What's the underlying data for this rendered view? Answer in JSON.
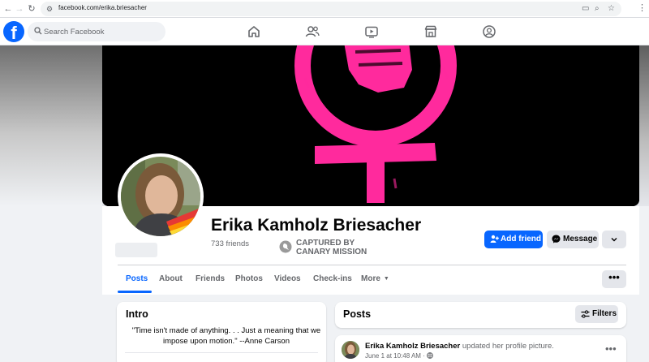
{
  "browser": {
    "url": "facebook.com/erika.briesacher"
  },
  "fb_header": {
    "search_placeholder": "Search Facebook",
    "nav_icons": [
      "home-icon",
      "friends-icon",
      "watch-icon",
      "marketplace-icon",
      "groups-icon"
    ]
  },
  "profile": {
    "name": "Erika Kamholz Briesacher",
    "friends": "733 friends",
    "badge_line1": "CAPTURED BY",
    "badge_line2": "CANARY MISSION"
  },
  "actions": {
    "add_friend": "Add friend",
    "message": "Message"
  },
  "tabs": [
    {
      "label": "Posts",
      "active": true
    },
    {
      "label": "About"
    },
    {
      "label": "Friends"
    },
    {
      "label": "Photos"
    },
    {
      "label": "Videos"
    },
    {
      "label": "Check-ins"
    },
    {
      "label": "More"
    }
  ],
  "intro": {
    "title": "Intro",
    "bio": "\"Time isn't made of anything. . . Just a meaning that we impose upon motion.\" --Anne Carson"
  },
  "posts": {
    "title": "Posts",
    "filters_label": "Filters",
    "items": [
      {
        "author": "Erika Kamholz Briesacher",
        "action": "updated her profile picture.",
        "timestamp": "June 1 at 10:48 AM",
        "privacy": "·"
      }
    ]
  },
  "colors": {
    "brand": "#0866ff",
    "cover_symbol": "#ff2a9d",
    "page_bg": "#f0f2f5"
  }
}
